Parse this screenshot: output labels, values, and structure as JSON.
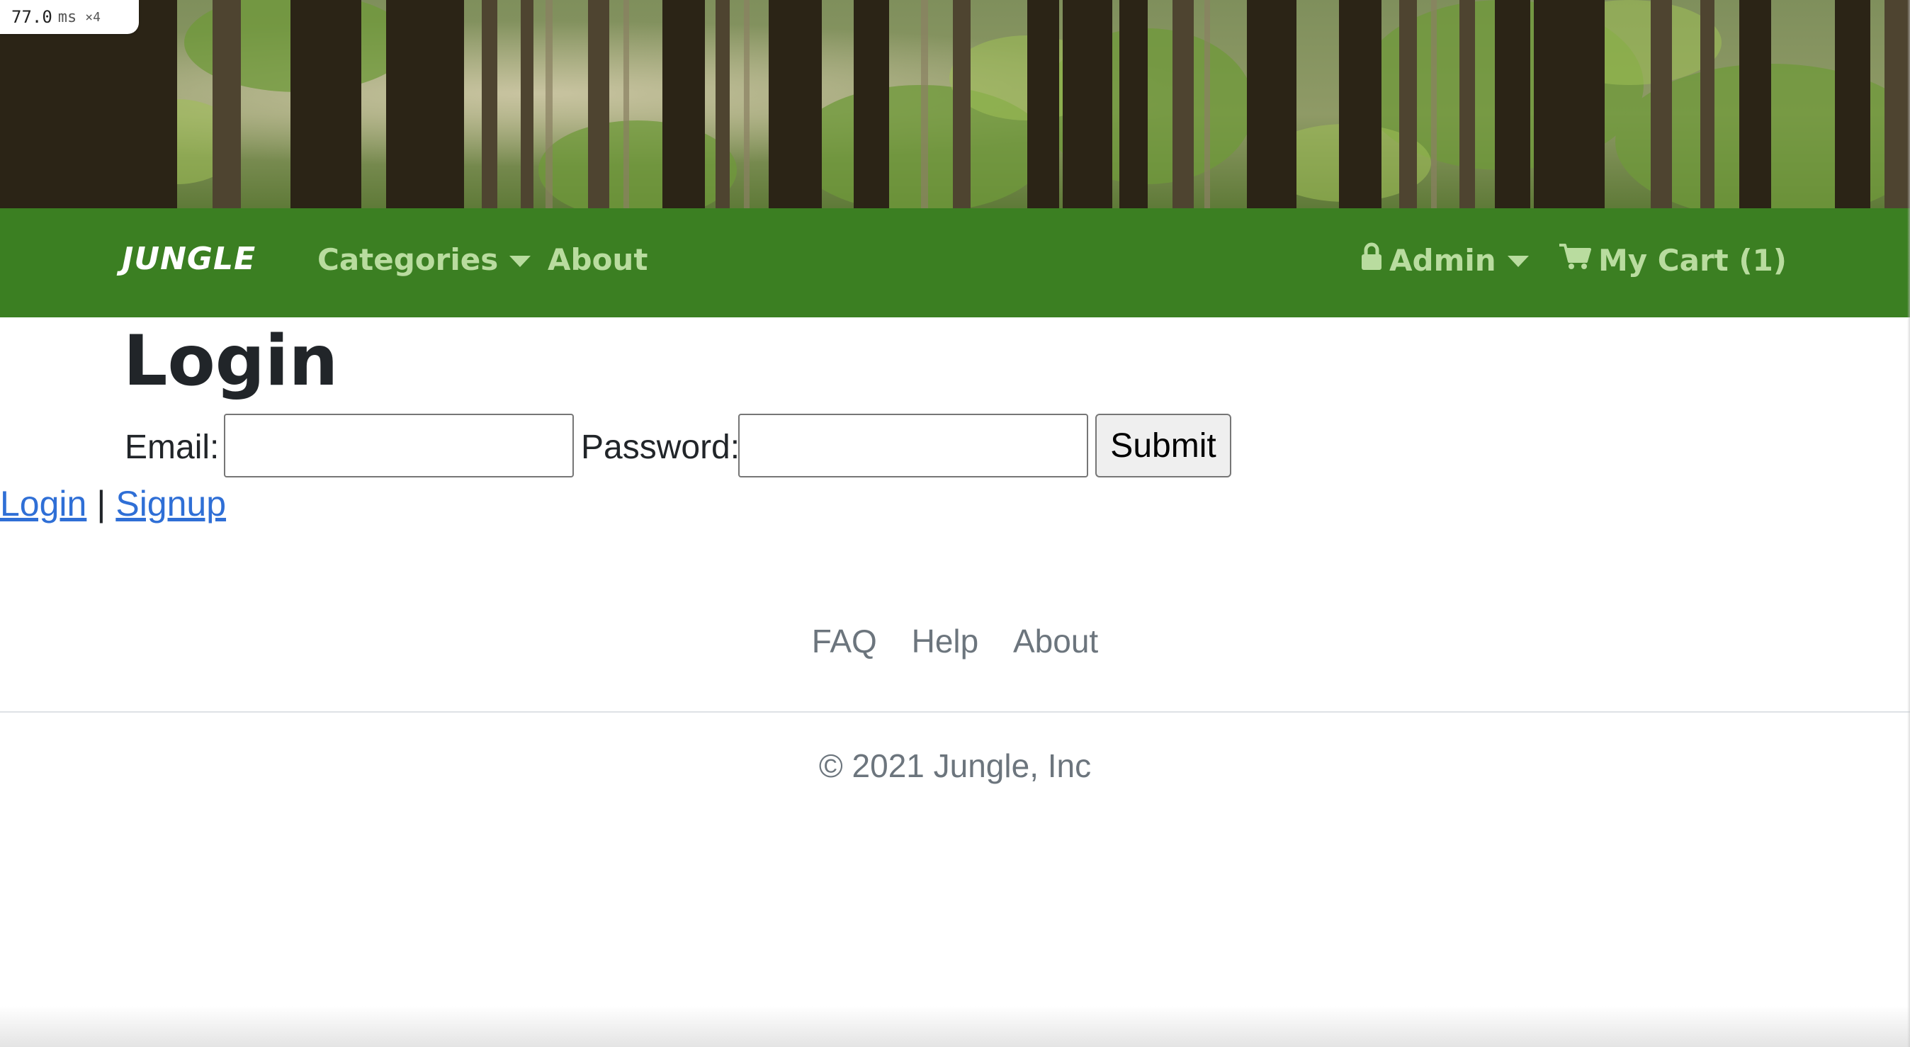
{
  "perf": {
    "value": "77.0",
    "unit": "ms",
    "multiplier": "×4"
  },
  "banner": {
    "image": "forest-trees-banner"
  },
  "navbar": {
    "bg_color": "#3b7f22",
    "link_color": "#b9dc9f",
    "brand": "JUNGLE",
    "categories": "Categories",
    "about": "About",
    "admin": "Admin",
    "cart": "My Cart (1)",
    "icons": {
      "admin": "lock-icon",
      "cart": "cart-icon",
      "dropdown": "caret-down-icon"
    }
  },
  "main": {
    "title": "Login",
    "email_label": "Email:",
    "email_value": "",
    "password_label": "Password:",
    "password_value": "",
    "submit_label": "Submit",
    "login_link": "Login",
    "separator": "|",
    "signup_link": "Signup",
    "link_color": "#2f6fd6"
  },
  "footer": {
    "faq": "FAQ",
    "help": "Help",
    "about": "About",
    "copyright": "© 2021 Jungle, Inc"
  }
}
